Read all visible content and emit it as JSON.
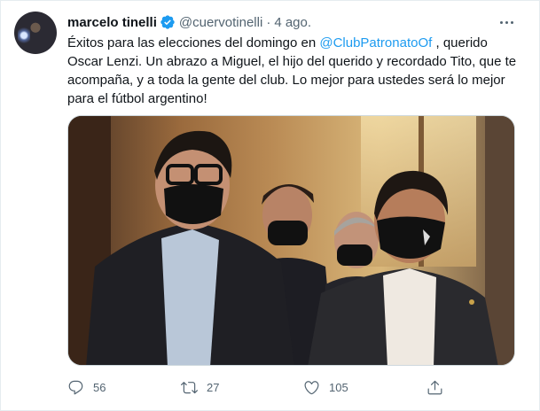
{
  "tweet": {
    "author_name": "marcelo tinelli",
    "handle": "@cuervotinelli",
    "separator": "·",
    "time": "4 ago.",
    "text_before": "Éxitos para las elecciones del domingo en ",
    "mention": "@ClubPatronatoOf",
    "text_after": " , querido Oscar Lenzi. Un abrazo a Miguel, el hijo del querido y recordado Tito, que te acompaña, y a toda la gente del club. Lo mejor para ustedes será lo mejor para el fútbol argentino!"
  },
  "actions": {
    "reply_count": "56",
    "retweet_count": "27",
    "like_count": "105"
  },
  "colors": {
    "accent": "#1d9bf0",
    "secondary_text": "#536471",
    "primary_text": "#0f1419"
  },
  "icons": [
    "verified-badge-icon",
    "more-icon",
    "reply-icon",
    "retweet-icon",
    "like-icon",
    "share-icon"
  ]
}
